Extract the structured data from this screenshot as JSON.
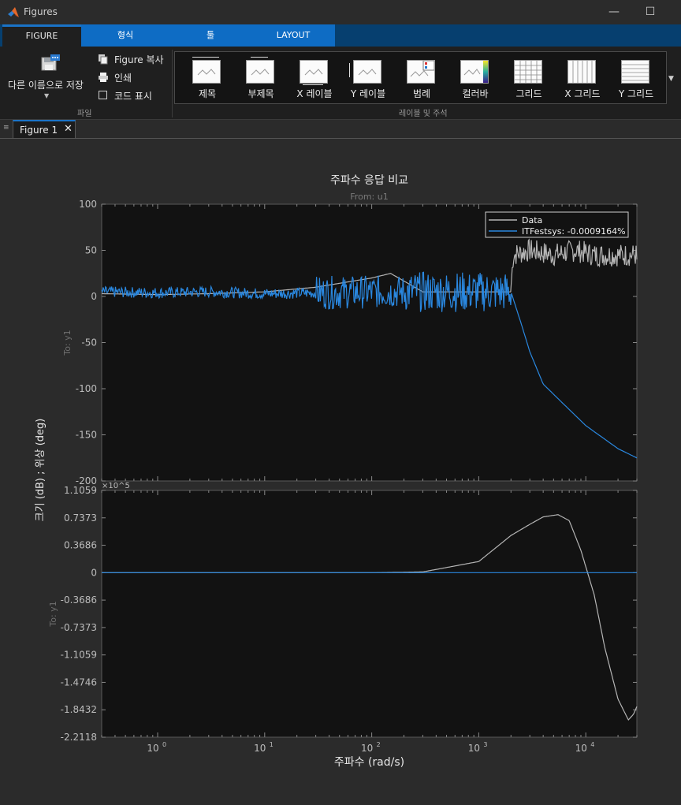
{
  "window": {
    "title": "Figures",
    "minimize_glyph": "—",
    "maximize_glyph": "☐"
  },
  "tabs": [
    {
      "label": "FIGURE"
    },
    {
      "label": "형식"
    },
    {
      "label": "툴"
    },
    {
      "label": "LAYOUT"
    }
  ],
  "ribbon": {
    "file_group": {
      "save_as_label": "다른 이름으로 저장",
      "copy_figure_label": "Figure 복사",
      "print_label": "인쇄",
      "show_code_label": "코드 표시",
      "group_label": "파일"
    },
    "labels_group": {
      "items": [
        {
          "label": "제목",
          "icon": "title-icon"
        },
        {
          "label": "부제목",
          "icon": "subtitle-icon"
        },
        {
          "label": "X 레이블",
          "icon": "xlabel-icon"
        },
        {
          "label": "Y 레이블",
          "icon": "ylabel-icon"
        },
        {
          "label": "범례",
          "icon": "legend-icon"
        },
        {
          "label": "컬러바",
          "icon": "colorbar-icon"
        },
        {
          "label": "그리드",
          "icon": "grid-icon"
        },
        {
          "label": "X 그리드",
          "icon": "xgrid-icon"
        },
        {
          "label": "Y 그리드",
          "icon": "ygrid-icon"
        }
      ],
      "group_label": "레이블 및 주석"
    }
  },
  "document_tab": {
    "label": "Figure 1",
    "close_glyph": "✕"
  },
  "colors": {
    "data_line": "#b5b5b5",
    "model_line": "#2a88e0",
    "axes_bg": "#121212",
    "accent": "#1a73c7"
  },
  "chart_data": {
    "type": "line",
    "title": "주파수 응답 비교",
    "subtitle": "From: u1",
    "xlabel": "주파수  (rad/s)",
    "ylabel": "크기 (dB) ; 위상 (deg)",
    "xscale": "log",
    "xlim": [
      0.3,
      30000
    ],
    "x_tick_labels": [
      "10^0",
      "10^1",
      "10^2",
      "10^3",
      "10^4"
    ],
    "legend": {
      "placement": "top-right",
      "entries": [
        "Data",
        "ITFestsys: -0.0009164%"
      ]
    },
    "panels": [
      {
        "name": "magnitude",
        "row_label": "To: y1",
        "ylim": [
          -200,
          100
        ],
        "y_ticks": [
          "100",
          "50",
          "0",
          "-50",
          "-100",
          "-150",
          "-200"
        ],
        "series": [
          {
            "name": "Data",
            "x": [
              0.3,
              1,
              3,
              10,
              30,
              100,
              150,
              300,
              1000,
              2000,
              2100,
              3000,
              5000,
              8000,
              12000,
              20000,
              30000
            ],
            "y": [
              3,
              2,
              3,
              5,
              10,
              20,
              25,
              5,
              5,
              5,
              40,
              45,
              40,
              45,
              40,
              40,
              40
            ]
          },
          {
            "name": "ITFestsys: -0.0009164%",
            "x": [
              0.3,
              1,
              3,
              10,
              100,
              1000,
              2000,
              2500,
              3000,
              4000,
              6000,
              10000,
              20000,
              30000
            ],
            "y": [
              5,
              4,
              5,
              3,
              5,
              5,
              5,
              -30,
              -60,
              -95,
              -115,
              -140,
              -165,
              -175
            ]
          }
        ]
      },
      {
        "name": "phase",
        "row_label": "To: y1",
        "exponent_label": "×10^5",
        "ylim": [
          -2.2118,
          1.1059
        ],
        "y_ticks": [
          "1.1059",
          "0.7373",
          "0.3686",
          "0",
          "-0.3686",
          "-0.7373",
          "-1.1059",
          "-1.4746",
          "-1.8432",
          "-2.2118"
        ],
        "series": [
          {
            "name": "Data",
            "x": [
              0.3,
              100,
              300,
              1000,
              2000,
              3000,
              4000,
              5500,
              7000,
              9000,
              12000,
              15000,
              20000,
              25000,
              28000,
              30000
            ],
            "y": [
              0,
              0,
              0.01,
              0.15,
              0.5,
              0.65,
              0.75,
              0.78,
              0.7,
              0.3,
              -0.3,
              -1.0,
              -1.7,
              -1.98,
              -1.9,
              -1.8
            ]
          },
          {
            "name": "ITFestsys: -0.0009164%",
            "x": [
              0.3,
              30000
            ],
            "y": [
              0,
              0
            ]
          }
        ]
      }
    ]
  }
}
